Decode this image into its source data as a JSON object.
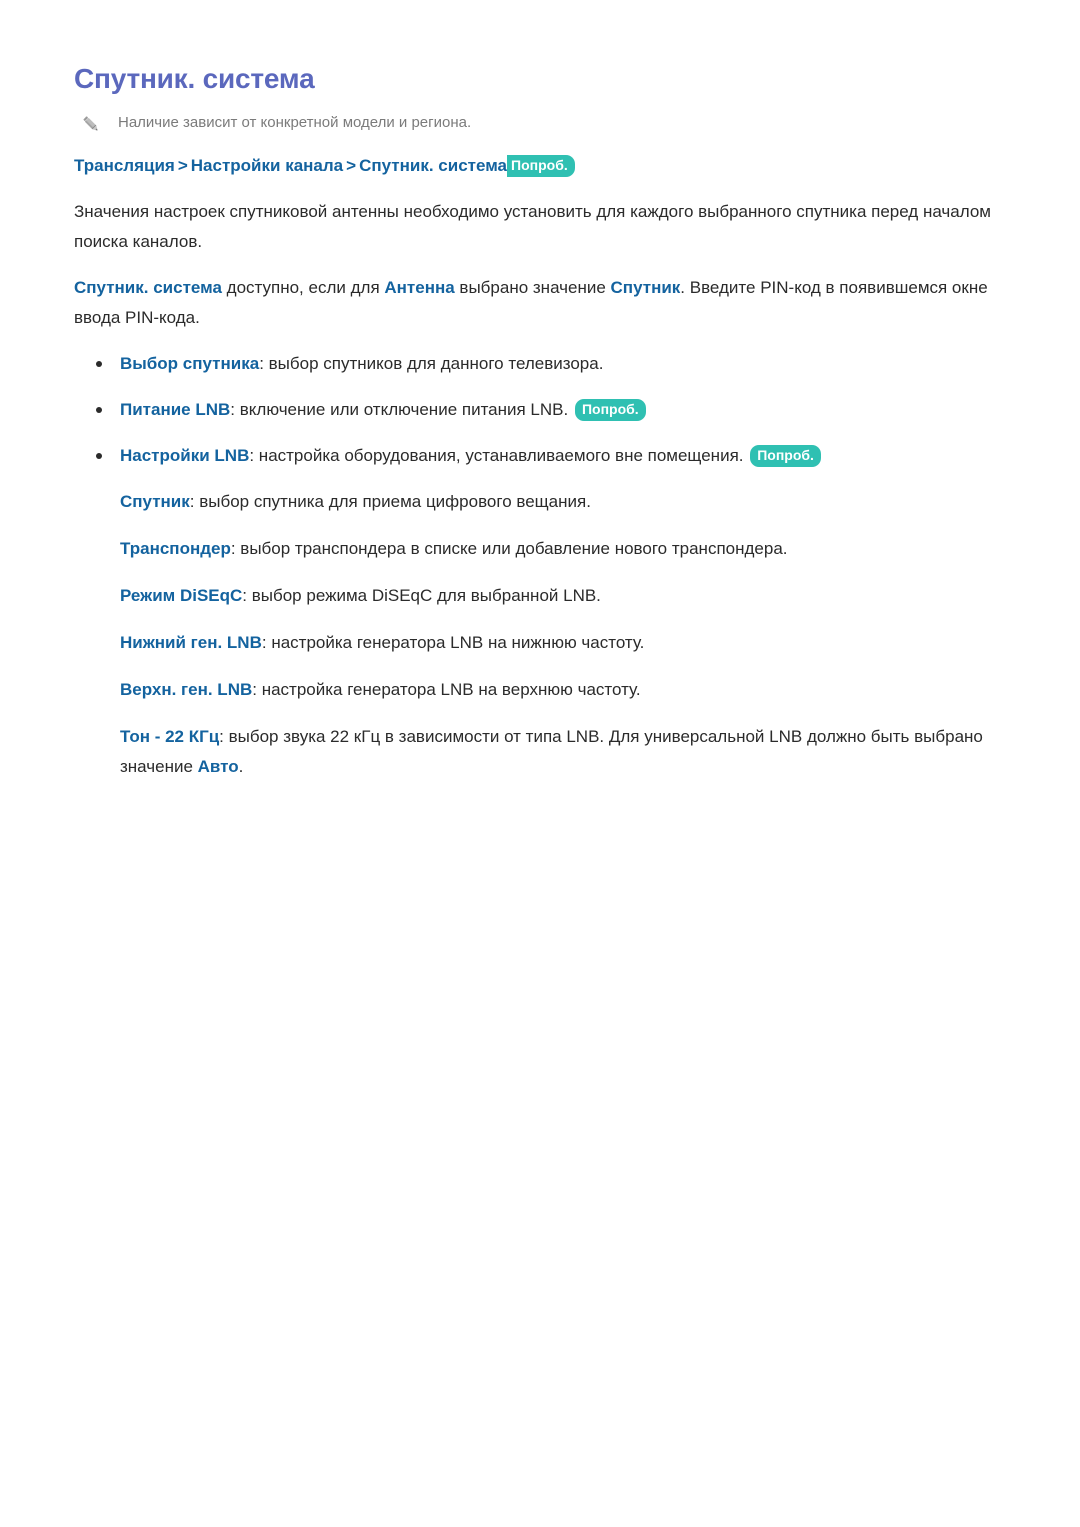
{
  "page": {
    "title": "Спутник. система",
    "note": {
      "icon": "pencil-icon",
      "text": "Наличие зависит от конкретной модели и региона."
    },
    "breadcrumb": {
      "items": [
        "Трансляция",
        "Настройки канала",
        "Спутник. система"
      ],
      "separator": ">",
      "badge": "Попроб."
    },
    "intro_paragraph": "Значения настроек спутниковой антенны необходимо установить для каждого выбранного спутника перед началом поиска каналов.",
    "availability_paragraph": {
      "term_1": "Спутник. система",
      "text_1": " доступно, если для ",
      "term_2": "Антенна",
      "text_2": " выбрано значение ",
      "term_3": "Спутник",
      "text_3": ". Введите PIN-код в появившемся окне ввода PIN-кода."
    },
    "bullets": [
      {
        "term": "Выбор спутника",
        "text": ": выбор спутников для данного телевизора.",
        "badge": ""
      },
      {
        "term": "Питание LNB",
        "text": ": включение или отключение питания LNB. ",
        "badge": "Попроб."
      },
      {
        "term": "Настройки LNB",
        "text": ": настройка оборудования, устанавливаемого вне помещения. ",
        "badge": "Попроб."
      }
    ],
    "sub_items": [
      {
        "term": "Спутник",
        "text": ": выбор спутника для приема цифрового вещания."
      },
      {
        "term": "Транспондер",
        "text": ": выбор транспондера в списке или добавление нового транспондера."
      },
      {
        "term": "Режим DiSEqC",
        "text": ": выбор режима DiSEqC для выбранной LNB."
      },
      {
        "term": "Нижний ген. LNB",
        "text": ": настройка генератора LNB на нижнюю частоту."
      },
      {
        "term": "Верхн. ген. LNB",
        "text": ": настройка генератора LNB на верхнюю частоту."
      }
    ],
    "tone_item": {
      "term": "Тон - 22 КГц",
      "text_1": ": выбор звука 22 кГц в зависимости от типа LNB. Для универсальной LNB должно быть выбрано значение ",
      "term_2": "Авто",
      "text_2": "."
    }
  },
  "colors": {
    "title": "#5b68bd",
    "link": "#14639f",
    "badge_bg": "#2fc0b2",
    "badge_text": "#ffffff",
    "body_text": "#2b2b2b",
    "note_text": "#7b7b7b",
    "background": "#ffffff"
  }
}
